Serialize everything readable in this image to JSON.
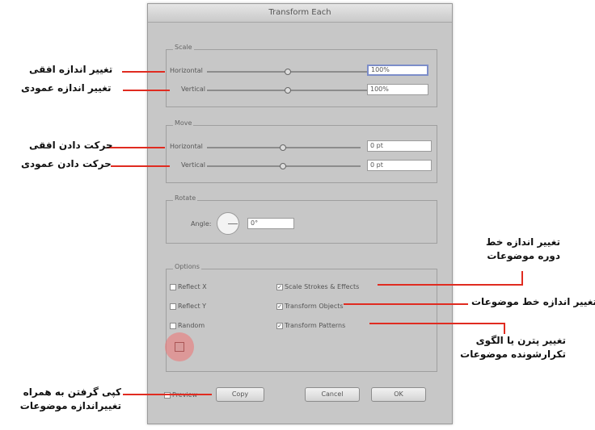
{
  "dialog": {
    "title": "Transform Each",
    "scale": {
      "label": "Scale",
      "horizontal_label": "Horizontal",
      "horizontal_value": "100%",
      "vertical_label": "Vertical",
      "vertical_value": "100%"
    },
    "move": {
      "label": "Move",
      "horizontal_label": "Horizontal",
      "horizontal_value": "0 pt",
      "vertical_label": "Vertical",
      "vertical_value": "0 pt"
    },
    "rotate": {
      "label": "Rotate",
      "angle_label": "Angle:",
      "angle_value": "0°"
    },
    "options": {
      "label": "Options",
      "reflect_x": "Reflect X",
      "reflect_y": "Reflect Y",
      "random": "Random",
      "scale_strokes": "Scale Strokes & Effects",
      "transform_objects": "Transform Objects",
      "transform_patterns": "Transform Patterns"
    },
    "footer": {
      "preview": "Preview",
      "copy": "Copy",
      "cancel": "Cancel",
      "ok": "OK"
    }
  },
  "annotations": {
    "scale_horizontal": "تغییر اندازه افقی",
    "scale_vertical": "تغییر اندازه عمودی",
    "move_horizontal": "حرکت دادن افقی",
    "move_vertical": "حرکت دادن عمودی",
    "scale_strokes": "تغییر اندازه خط دوره موضوعات",
    "transform_objects": "تغییر اندازه خط موضوعات",
    "transform_patterns": "تغییر پترن یا الگوی تکرارشونده موضوعات",
    "copy": "کپی گرفتن به همراه تغییراندازه موضوعات"
  },
  "colors": {
    "annotation_line": "#e02b20",
    "dialog_bg": "#c7c7c7",
    "active_field_border": "#7c8dc9"
  }
}
